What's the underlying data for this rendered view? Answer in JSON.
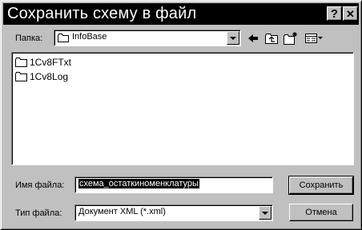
{
  "window": {
    "title": "Сохранить схему в файл",
    "help_label": "?",
    "close_label": "✕"
  },
  "folder": {
    "label": "Папка:",
    "value": "InfoBase"
  },
  "toolbar": {
    "back_icon": "back-arrow-icon",
    "up_icon": "up-one-level-icon",
    "new_folder_icon": "new-folder-icon",
    "view_icon": "view-menu-icon"
  },
  "files": [
    {
      "name": "1Cv8FTxt",
      "icon": "folder-icon"
    },
    {
      "name": "1Cv8Log",
      "icon": "folder-icon"
    }
  ],
  "filename": {
    "label": "Имя файла:",
    "value": "схема_остаткиноменклатуры"
  },
  "filetype": {
    "label": "Тип файла:",
    "value": "Документ XML (*.xml)"
  },
  "buttons": {
    "save": "Сохранить",
    "cancel": "Отмена"
  }
}
